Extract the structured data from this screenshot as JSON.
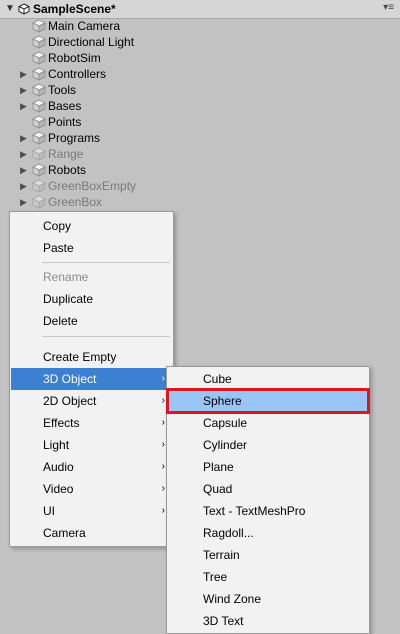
{
  "header": {
    "title": "SampleScene*"
  },
  "hierarchy": {
    "items": [
      {
        "label": "Main Camera",
        "expandable": false,
        "disabled": false
      },
      {
        "label": "Directional Light",
        "expandable": false,
        "disabled": false
      },
      {
        "label": "RobotSim",
        "expandable": false,
        "disabled": false
      },
      {
        "label": "Controllers",
        "expandable": true,
        "disabled": false
      },
      {
        "label": "Tools",
        "expandable": true,
        "disabled": false
      },
      {
        "label": "Bases",
        "expandable": true,
        "disabled": false
      },
      {
        "label": "Points",
        "expandable": false,
        "disabled": false
      },
      {
        "label": "Programs",
        "expandable": true,
        "disabled": false
      },
      {
        "label": "Range",
        "expandable": true,
        "disabled": true
      },
      {
        "label": "Robots",
        "expandable": true,
        "disabled": false
      },
      {
        "label": "GreenBoxEmpty",
        "expandable": true,
        "disabled": true
      },
      {
        "label": "GreenBox",
        "expandable": true,
        "disabled": true
      }
    ]
  },
  "context_menu": {
    "items": [
      {
        "label": "Copy",
        "disabled": false,
        "submenu": false
      },
      {
        "label": "Paste",
        "disabled": false,
        "submenu": false
      },
      {
        "label": "Rename",
        "disabled": true,
        "submenu": false
      },
      {
        "label": "Duplicate",
        "disabled": false,
        "submenu": false
      },
      {
        "label": "Delete",
        "disabled": false,
        "submenu": false
      },
      {
        "label": "Create Empty",
        "disabled": false,
        "submenu": false
      },
      {
        "label": "3D Object",
        "disabled": false,
        "submenu": true,
        "active": true
      },
      {
        "label": "2D Object",
        "disabled": false,
        "submenu": true
      },
      {
        "label": "Effects",
        "disabled": false,
        "submenu": true
      },
      {
        "label": "Light",
        "disabled": false,
        "submenu": true
      },
      {
        "label": "Audio",
        "disabled": false,
        "submenu": true
      },
      {
        "label": "Video",
        "disabled": false,
        "submenu": true
      },
      {
        "label": "UI",
        "disabled": false,
        "submenu": true
      },
      {
        "label": "Camera",
        "disabled": false,
        "submenu": false
      }
    ]
  },
  "submenu_3d_object": {
    "items": [
      {
        "label": "Cube"
      },
      {
        "label": "Sphere",
        "highlighted": true
      },
      {
        "label": "Capsule"
      },
      {
        "label": "Cylinder"
      },
      {
        "label": "Plane"
      },
      {
        "label": "Quad"
      },
      {
        "label": "Text - TextMeshPro"
      },
      {
        "label": "Ragdoll..."
      },
      {
        "label": "Terrain"
      },
      {
        "label": "Tree"
      },
      {
        "label": "Wind Zone"
      },
      {
        "label": "3D Text"
      }
    ]
  },
  "colors": {
    "background": "#c2c2c2",
    "menu_bg": "#f2f2f2",
    "selection_blue": "#3d7fd1",
    "hover_blue": "#99c6f7",
    "highlight_red": "#e0141e"
  },
  "icons": {
    "fold": "triangle-right",
    "expand": "triangle-down",
    "object": "cube-icon",
    "menu": "options-menu-icon"
  }
}
